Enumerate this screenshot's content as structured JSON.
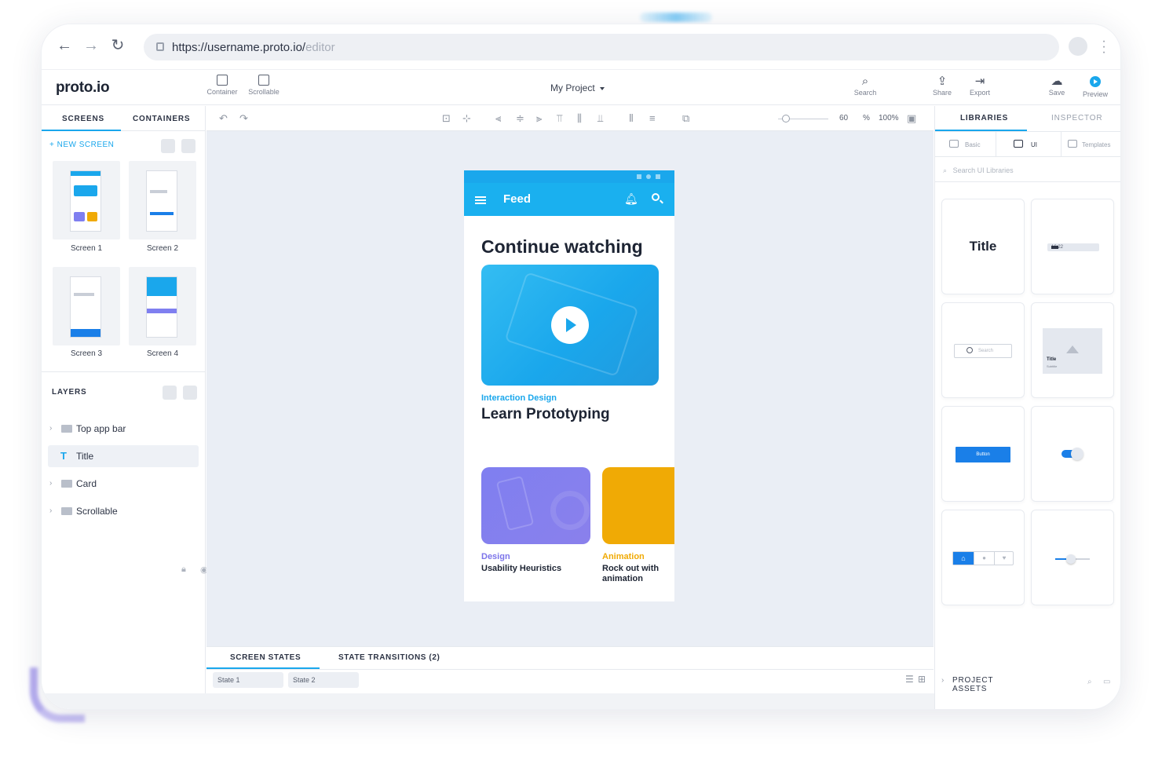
{
  "browser": {
    "url_main": "https://username.proto.io/",
    "url_dim": "editor"
  },
  "app": {
    "logo": "proto.io",
    "tools": [
      {
        "label": "Container"
      },
      {
        "label": "Scrollable"
      }
    ],
    "project": "My Project",
    "right_tools": [
      {
        "label": "Search"
      },
      {
        "label": "Share"
      },
      {
        "label": "Export"
      },
      {
        "label": "Save"
      },
      {
        "label": "Preview"
      }
    ]
  },
  "left": {
    "tabs": [
      "SCREENS",
      "CONTAINERS"
    ],
    "new_screen": "+ NEW SCREEN",
    "screens": [
      "Screen 1",
      "Screen 2",
      "Screen 3",
      "Screen 4"
    ],
    "layers_title": "LAYERS",
    "layers": [
      "Top app bar",
      "Title",
      "Card",
      "Scrollable"
    ]
  },
  "canvas": {
    "zoom_value": "60",
    "zoom_unit": "%",
    "zoom_fit": "100%"
  },
  "phone": {
    "appbar_title": "Feed",
    "heading": "Continue watching",
    "category1": "Interaction Design",
    "title1": "Learn Prototyping",
    "category2": "Design",
    "title2": "Usability Heuristics",
    "category3": "Animation",
    "title3": "Rock out with animation"
  },
  "states": {
    "tabs": [
      "SCREEN STATES",
      "STATE TRANSITIONS (2)"
    ],
    "items": [
      "State 1",
      "State 2"
    ]
  },
  "right": {
    "tabs": [
      "LIBRARIES",
      "INSPECTOR"
    ],
    "subtabs": [
      "Basic",
      "UI",
      "Templates"
    ],
    "search_placeholder": "Search UI Libraries",
    "components": {
      "title": "Title",
      "status_time": "16:22",
      "search": "Search",
      "card_title": "Title",
      "card_sub": "Subtitle",
      "button": "Button"
    },
    "project_assets": "PROJECT ASSETS"
  },
  "colors": {
    "accent": "#1aa7ec",
    "purple": "#7c74ea",
    "yellow": "#f0aa05",
    "blue_button": "#1a7fe8"
  }
}
